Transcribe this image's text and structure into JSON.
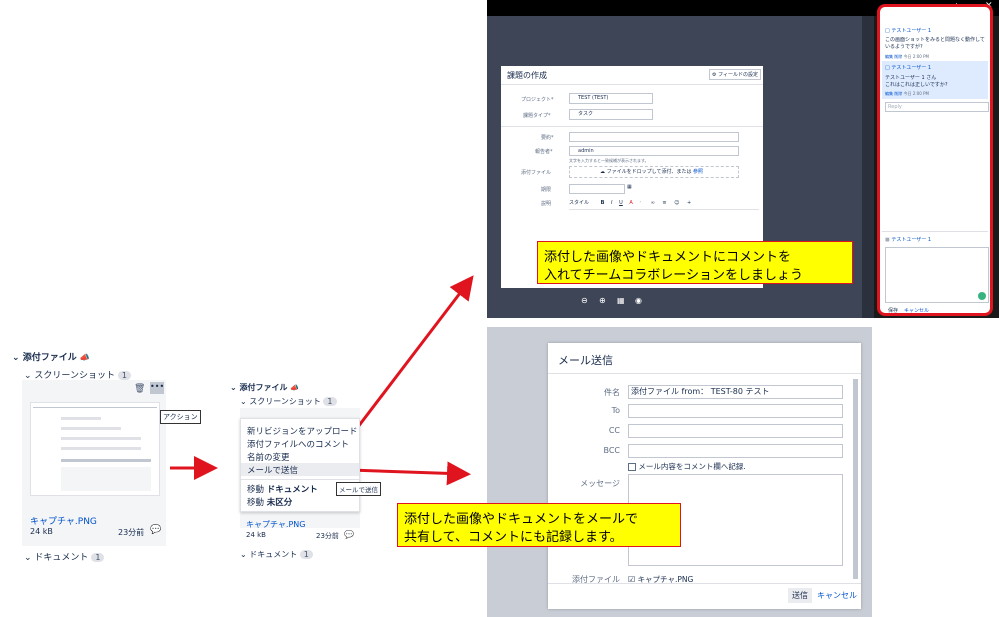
{
  "colors": {
    "red": "#e0141e",
    "callout_bg": "#ffff00",
    "link": "#0052cc"
  },
  "left_panel": {
    "section_title": "添付ファイル",
    "screenshots_label": "スクリーンショット",
    "screenshots_count": "1",
    "tooltip_action": "アクション",
    "file_name": "キャプチャ.PNG",
    "file_size": "24 kB",
    "file_time": "23分前",
    "documents_label": "ドキュメント",
    "documents_count": "1"
  },
  "middle_panel": {
    "section_title": "添付ファイル",
    "screenshots_label": "スクリーンショット",
    "screenshots_count": "1",
    "menu_items": [
      "新リビジョンをアップロード",
      "添付ファイルへのコメント",
      "名前の変更",
      "メールで送信"
    ],
    "move_doc_prefix": "移動",
    "move_doc_target": "ドキュメント",
    "move_unc_prefix": "移動",
    "move_unc_target": "未区分",
    "tooltip_mail": "メールで送信",
    "file_name": "キャプチャ.PNG",
    "file_size": "24 kB",
    "file_time": "23分前",
    "documents_label": "ドキュメント",
    "documents_count": "1"
  },
  "issue_dialog": {
    "title": "課題の作成",
    "config_button": "フィールドの設定",
    "project_label": "プロジェクト*",
    "project_value": "TEST (TEST)",
    "type_label": "課題タイプ*",
    "type_value": "タスク",
    "summary_label": "要約*",
    "reporter_label": "報告者*",
    "reporter_value": "admin",
    "reporter_hint": "文字を入力すると一致候補が表示されます。",
    "attach_label": "添付ファイル",
    "attach_drop": "ファイルをドロップして添付、または",
    "attach_browse": "参照",
    "due_label": "期限",
    "desc_label": "説明",
    "style_label": "スタイル"
  },
  "comment_panel": {
    "user1": "テストユーザー 1",
    "comment1": "この画面ショットをみると問題なく動作しているようですが?",
    "actions1": [
      "編集",
      "削除",
      "今日 2:00 PM"
    ],
    "user2": "テストユーザー 1",
    "comment2_line1": "テストユーザー 1 さん",
    "comment2_line2": "これはこれは正しいですか?",
    "actions2": [
      "編集",
      "削除",
      "今日 2:00 PM"
    ],
    "reply_placeholder": "Reply",
    "composer_user": "テストユーザー 1",
    "save_label": "保存",
    "cancel_label": "キャンセル"
  },
  "callout_top": {
    "line1": "添付した画像やドキュメントにコメントを",
    "line2": "入れてチームコラボレーションをしましょう"
  },
  "mail_dialog": {
    "title": "メール送信",
    "subject_label": "件名",
    "subject_value": "添付ファイル from： TEST-80 テスト",
    "to_label": "To",
    "cc_label": "CC",
    "bcc_label": "BCC",
    "record_comment_label": "メール内容をコメント欄へ記録.",
    "message_label": "メッセージ",
    "attachments_label": "添付ファイル",
    "attachment_file": "キャプチャ.PNG",
    "send_label": "送信",
    "cancel_label": "キャンセル"
  },
  "callout_bottom": {
    "line1": "添付した画像やドキュメントをメールで",
    "line2": "共有して、コメントにも記録します。"
  }
}
